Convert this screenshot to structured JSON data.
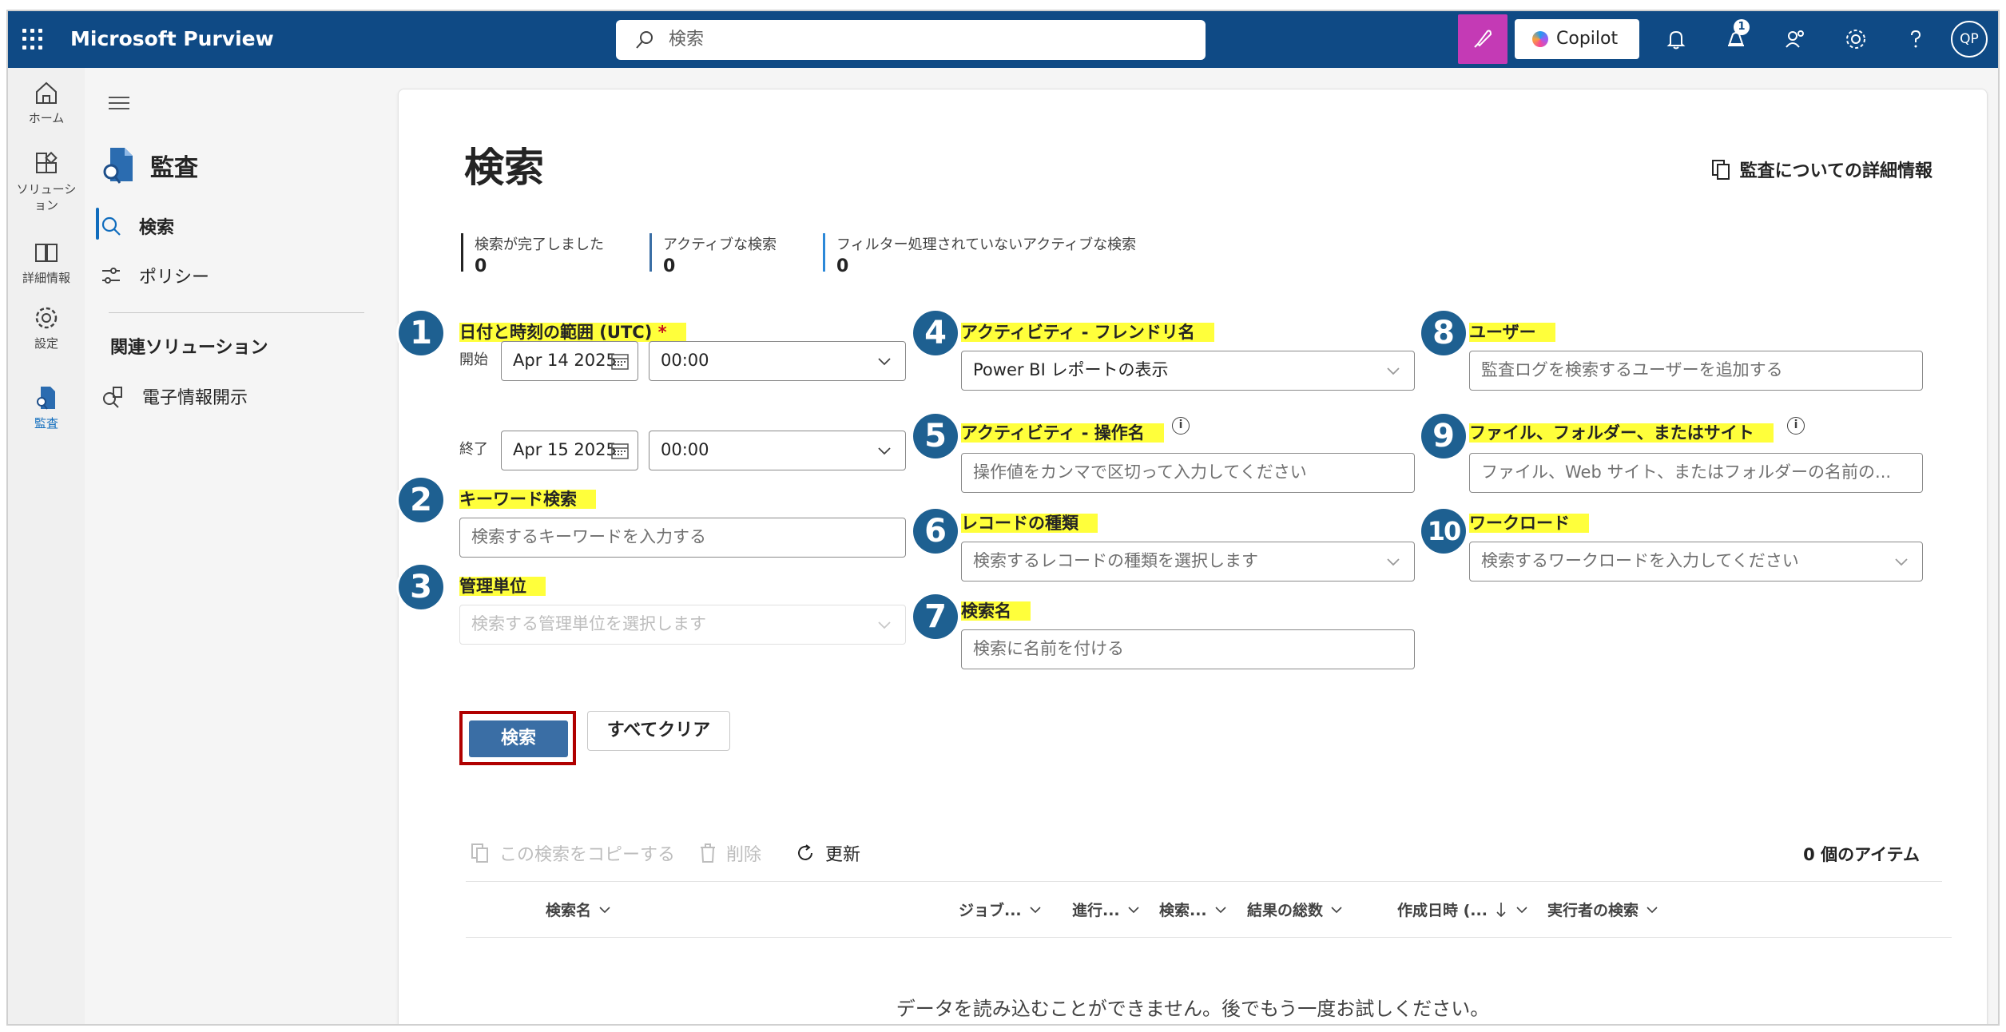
{
  "app": {
    "title": "Microsoft Purview",
    "search_placeholder": "検索",
    "copilot_label": "Copilot",
    "notification_count": "1",
    "avatar_initials": "QP"
  },
  "rail": {
    "items": [
      {
        "label": "ホーム",
        "icon": "home-icon"
      },
      {
        "label": "ソリューション",
        "icon": "solutions-icon"
      },
      {
        "label": "詳細情報",
        "icon": "book-icon"
      },
      {
        "label": "設定",
        "icon": "gear-icon"
      },
      {
        "label": "監査",
        "icon": "audit-icon"
      }
    ]
  },
  "nav": {
    "title": "監査",
    "items": [
      {
        "label": "検索",
        "icon": "search-icon"
      },
      {
        "label": "ポリシー",
        "icon": "policy-icon"
      }
    ],
    "related_heading": "関連ソリューション",
    "related": [
      {
        "label": "電子情報開示",
        "icon": "ediscovery-icon"
      }
    ]
  },
  "page": {
    "title": "検索",
    "learn_more": "監査についての詳細情報",
    "stats": [
      {
        "label": "検索が完了しました",
        "value": "0"
      },
      {
        "label": "アクティブな検索",
        "value": "0"
      },
      {
        "label": "フィルター処理されていないアクティブな検索",
        "value": "0"
      }
    ]
  },
  "form": {
    "date_range": {
      "number": "1",
      "label": "日付と時刻の範囲 (UTC)",
      "required": "*",
      "start_label": "開始",
      "start_date": "Apr 14 2025",
      "start_time": "00:00",
      "end_label": "終了",
      "end_date": "Apr 15 2025",
      "end_time": "00:00"
    },
    "keyword": {
      "number": "2",
      "label": "キーワード検索",
      "placeholder": "検索するキーワードを入力する"
    },
    "admin_units": {
      "number": "3",
      "label": "管理単位",
      "placeholder": "検索する管理単位を選択します"
    },
    "activity_friendly": {
      "number": "4",
      "label": "アクティビティ - フレンドリ名",
      "value": "Power BI レポートの表示"
    },
    "activity_operation": {
      "number": "5",
      "label": "アクティビティ - 操作名",
      "placeholder": "操作値をカンマで区切って入力してください"
    },
    "record_type": {
      "number": "6",
      "label": "レコードの種類",
      "placeholder": "検索するレコードの種類を選択します"
    },
    "search_name": {
      "number": "7",
      "label": "検索名",
      "placeholder": "検索に名前を付ける"
    },
    "users": {
      "number": "8",
      "label": "ユーザー",
      "placeholder": "監査ログを検索するユーザーを追加する"
    },
    "file_folder_site": {
      "number": "9",
      "label": "ファイル、フォルダー、またはサイト",
      "placeholder": "ファイル、Web サイト、またはフォルダーの名前の..."
    },
    "workload": {
      "number": "10",
      "label": "ワークロード",
      "placeholder": "検索するワークロードを入力してください"
    }
  },
  "actions": {
    "search": "検索",
    "clear_all": "すべてクリア"
  },
  "results": {
    "toolbar": {
      "copy": "この検索をコピーする",
      "delete": "削除",
      "refresh": "更新"
    },
    "count": "0 個のアイテム",
    "columns": [
      "検索名",
      "ジョブ...",
      "進行...",
      "検索...",
      "結果の総数",
      "作成日時 (...",
      "実行者の検索"
    ],
    "empty_message": "データを読み込むことができません。後でもう一度お試しください。"
  }
}
